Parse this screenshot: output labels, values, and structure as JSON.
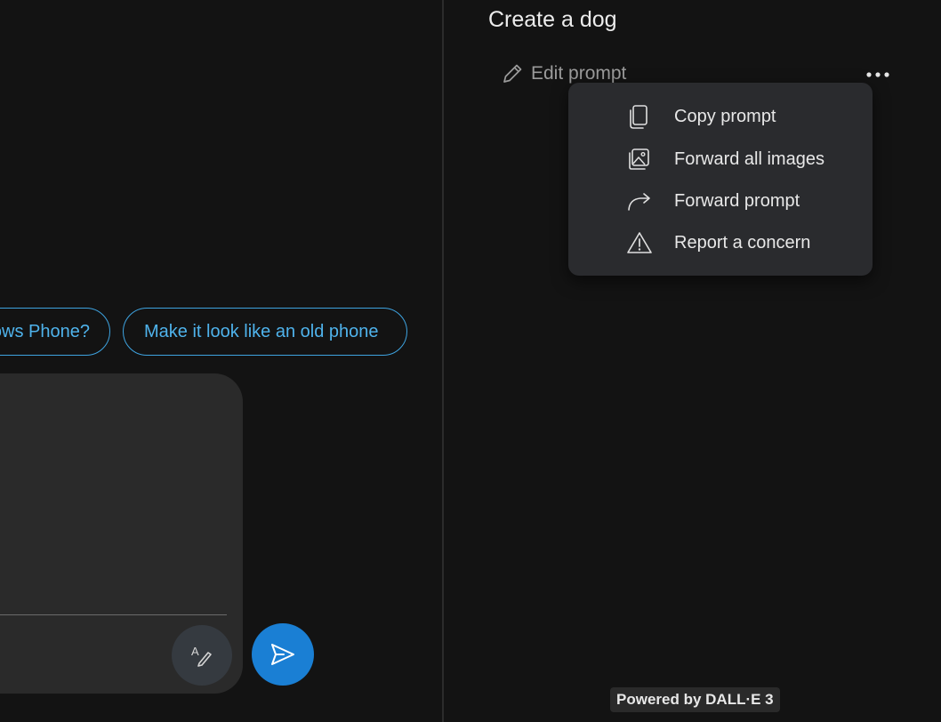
{
  "chat": {
    "suggestions": [
      {
        "label": "ows Phone?"
      },
      {
        "label": "Make it look like an old phone"
      }
    ],
    "composer": {
      "style_button": "change-style",
      "send_button": "send"
    }
  },
  "image_panel": {
    "title": "Create a dog",
    "edit_prompt_label": "Edit prompt",
    "more_menu": {
      "items": [
        {
          "label": "Copy prompt",
          "icon": "copy-icon"
        },
        {
          "label": "Forward all images",
          "icon": "images-icon"
        },
        {
          "label": "Forward prompt",
          "icon": "forward-arrow-icon"
        },
        {
          "label": "Report a concern",
          "icon": "warning-icon"
        }
      ]
    },
    "powered_by": "Powered by DALL·E 3"
  },
  "colors": {
    "background": "#131313",
    "accent": "#4fb3ec",
    "send_button": "#1a7fd4",
    "menu_bg": "#2a2b2e"
  }
}
